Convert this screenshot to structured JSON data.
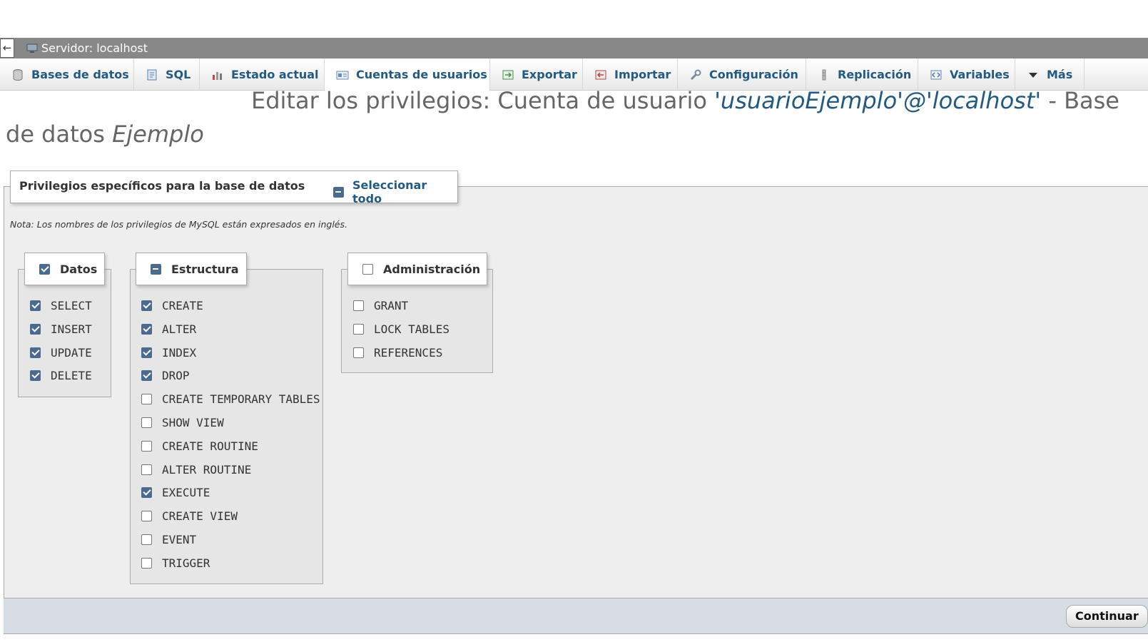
{
  "server": {
    "back_label": "←",
    "title": "Servidor: localhost"
  },
  "tabs": [
    {
      "label": "Bases de datos",
      "icon": "database-icon"
    },
    {
      "label": "SQL",
      "icon": "sql-icon"
    },
    {
      "label": "Estado actual",
      "icon": "status-icon"
    },
    {
      "label": "Cuentas de usuarios",
      "icon": "users-icon",
      "active": true
    },
    {
      "label": "Exportar",
      "icon": "export-icon"
    },
    {
      "label": "Importar",
      "icon": "import-icon"
    },
    {
      "label": "Configuración",
      "icon": "wrench-icon"
    },
    {
      "label": "Replicación",
      "icon": "replication-icon"
    },
    {
      "label": "Variables",
      "icon": "variables-icon"
    },
    {
      "label": "Más",
      "icon": "chevron-down-icon"
    }
  ],
  "heading": {
    "prefix": "Editar los privilegios: Cuenta de usuario",
    "user": "'usuarioEjemplo'@'localhost'",
    "middle": "- Base de datos",
    "db": "Ejemplo"
  },
  "privileges": {
    "legend": "Privilegios específicos para la base de datos",
    "select_all": "Seleccionar todo",
    "note": "Nota: Los nombres de los privilegios de MySQL están expresados en inglés.",
    "groups": {
      "datos": {
        "label": "Datos",
        "state": "checked",
        "items": [
          {
            "label": "SELECT",
            "checked": true
          },
          {
            "label": "INSERT",
            "checked": true
          },
          {
            "label": "UPDATE",
            "checked": true
          },
          {
            "label": "DELETE",
            "checked": true
          }
        ]
      },
      "estructura": {
        "label": "Estructura",
        "state": "indeterminate",
        "items": [
          {
            "label": "CREATE",
            "checked": true
          },
          {
            "label": "ALTER",
            "checked": true
          },
          {
            "label": "INDEX",
            "checked": true
          },
          {
            "label": "DROP",
            "checked": true
          },
          {
            "label": "CREATE TEMPORARY TABLES",
            "checked": false
          },
          {
            "label": "SHOW VIEW",
            "checked": false
          },
          {
            "label": "CREATE ROUTINE",
            "checked": false
          },
          {
            "label": "ALTER ROUTINE",
            "checked": false
          },
          {
            "label": "EXECUTE",
            "checked": true
          },
          {
            "label": "CREATE VIEW",
            "checked": false
          },
          {
            "label": "EVENT",
            "checked": false
          },
          {
            "label": "TRIGGER",
            "checked": false
          }
        ]
      },
      "administracion": {
        "label": "Administración",
        "state": "unchecked",
        "items": [
          {
            "label": "GRANT",
            "checked": false
          },
          {
            "label": "LOCK TABLES",
            "checked": false
          },
          {
            "label": "REFERENCES",
            "checked": false
          }
        ]
      }
    }
  },
  "footer": {
    "submit_label": "Continuar"
  },
  "colors": {
    "link": "#235a81",
    "checkbox_fill": "#4a6a8f",
    "server_bar": "#888888",
    "footer_bg": "#d6dde5"
  }
}
